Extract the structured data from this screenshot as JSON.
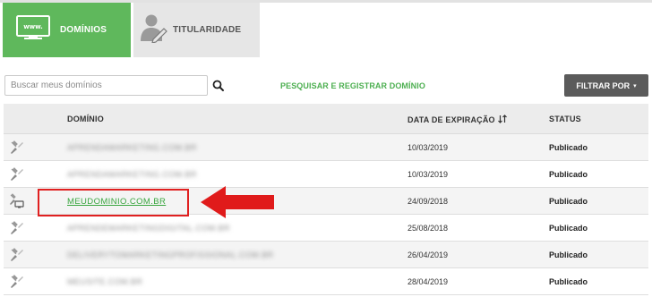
{
  "tabs": [
    {
      "label": "DOMÍNIOS",
      "icon": "www-monitor-icon",
      "active": true,
      "color": "#5fb85c"
    },
    {
      "label": "TITULARIDADE",
      "icon": "user-edit-icon",
      "active": false,
      "color": "#e6e6e6"
    }
  ],
  "search": {
    "placeholder": "Buscar meus domínios",
    "icon": "search-icon"
  },
  "register_link": "PESQUISAR E REGISTRAR DOMÍNIO",
  "filter": {
    "label": "FILTRAR POR",
    "caret": "▾",
    "color": "#5b5b5b"
  },
  "table": {
    "headers": {
      "domain": "DOMÍNIO",
      "expiration": "DATA DE EXPIRAÇÃO",
      "status": "STATUS"
    },
    "rows": [
      {
        "domain": "APRENDAMARKETING.COM.BR",
        "blurred": true,
        "date": "10/03/2019",
        "status": "Publicado",
        "icon": "edit-tool-icon"
      },
      {
        "domain": "APRENDAMARKETING.COM.BR",
        "blurred": true,
        "date": "10/03/2019",
        "status": "Publicado",
        "icon": "edit-tool-icon"
      },
      {
        "domain": "MEUDOMINIO.COM.BR",
        "blurred": false,
        "date": "24/09/2018",
        "status": "Publicado",
        "icon": "edit-monitor-icon"
      },
      {
        "domain": "APRENDEMARKETINGDIGITAL.COM.BR",
        "blurred": true,
        "date": "25/08/2018",
        "status": "Publicado",
        "icon": "edit-tool-icon"
      },
      {
        "domain": "DELIVERYTOMARKETINGPROFISSIONAL.COM.BR",
        "blurred": true,
        "date": "26/04/2019",
        "status": "Publicado",
        "icon": "edit-tool-icon"
      },
      {
        "domain": "MEUSITE.COM.BR",
        "blurred": true,
        "date": "28/04/2019",
        "status": "Publicado",
        "icon": "edit-tool-icon"
      }
    ]
  },
  "annotation": {
    "highlight_color": "#e02020"
  }
}
